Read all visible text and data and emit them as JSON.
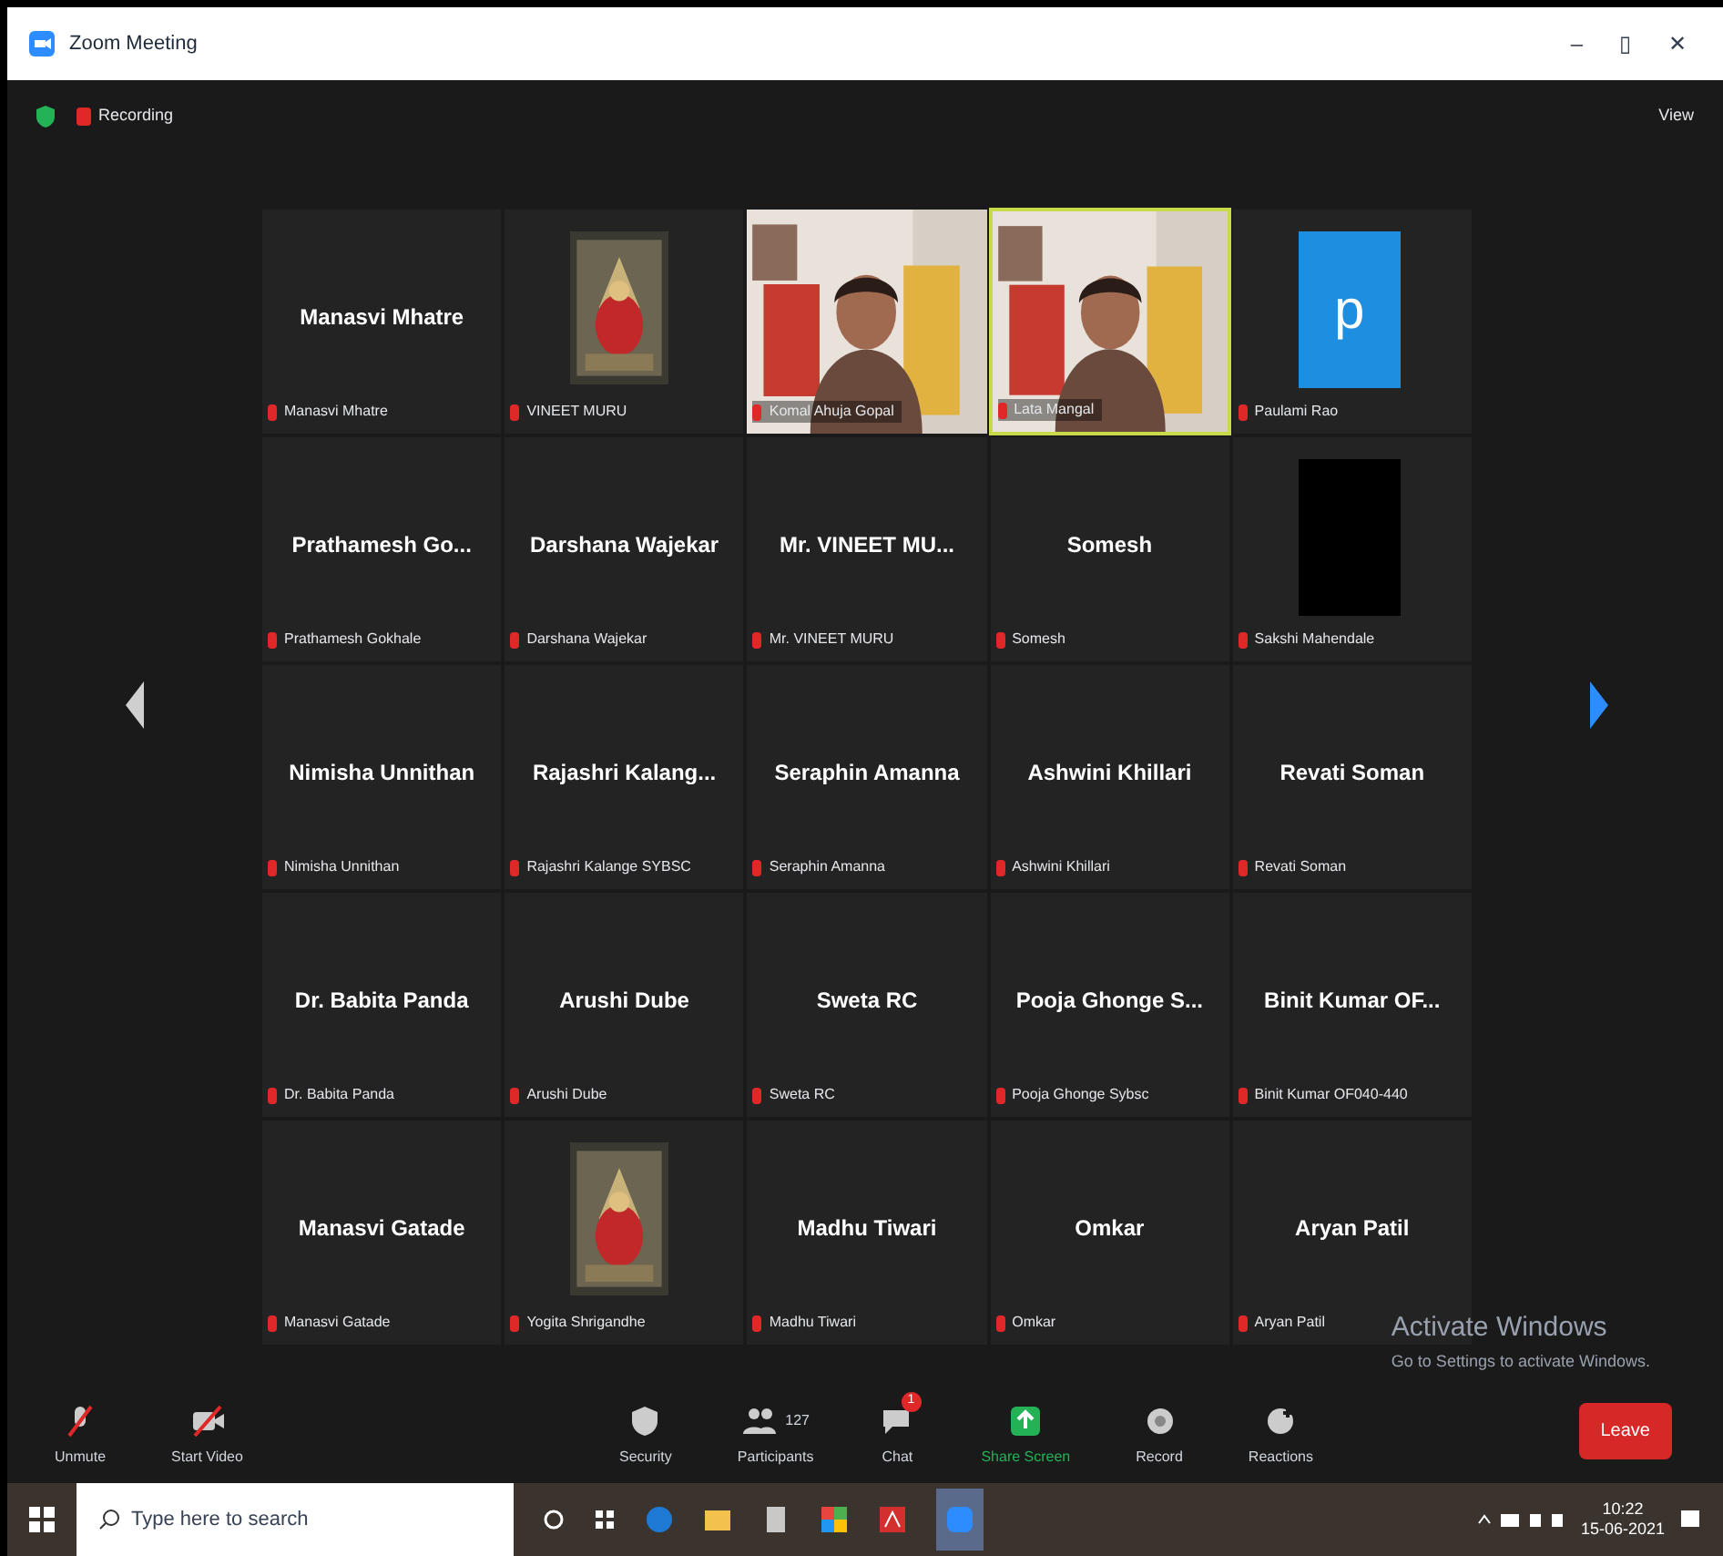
{
  "window": {
    "title": "Zoom Meeting",
    "controls": [
      "–",
      "▯",
      "✕"
    ]
  },
  "top_bar": {
    "recording": "Recording",
    "view": "View"
  },
  "tiles": [
    {
      "kind": "name",
      "name": "Manasvi Mhatre",
      "label": "Manasvi Mhatre",
      "speaking": false
    },
    {
      "kind": "picture",
      "label": "VINEET MURU",
      "speaking": false
    },
    {
      "kind": "video",
      "label": "Komal Ahuja Gopal",
      "speaking": false
    },
    {
      "kind": "video",
      "label": "Lata Mangal",
      "speaking": true
    },
    {
      "kind": "logo",
      "letter": "p",
      "label": "Paulami Rao",
      "speaking": false
    },
    {
      "kind": "name",
      "name": "Prathamesh Go...",
      "label": "Prathamesh Gokhale",
      "speaking": false
    },
    {
      "kind": "name",
      "name": "Darshana Wajekar",
      "label": "Darshana Wajekar",
      "speaking": false
    },
    {
      "kind": "name",
      "name": "Mr. VINEET MU...",
      "label": "Mr. VINEET MURU",
      "speaking": false
    },
    {
      "kind": "name",
      "name": "Somesh",
      "label": "Somesh",
      "speaking": false
    },
    {
      "kind": "blank",
      "label": "Sakshi Mahendale",
      "speaking": false
    },
    {
      "kind": "name",
      "name": "Nimisha Unnithan",
      "label": "Nimisha Unnithan",
      "speaking": false
    },
    {
      "kind": "name",
      "name": "Rajashri Kalang...",
      "label": "Rajashri Kalange SYBSC",
      "speaking": false
    },
    {
      "kind": "name",
      "name": "Seraphin Amanna",
      "label": "Seraphin Amanna",
      "speaking": false
    },
    {
      "kind": "name",
      "name": "Ashwini Khillari",
      "label": "Ashwini Khillari",
      "speaking": false
    },
    {
      "kind": "name",
      "name": "Revati Soman",
      "label": "Revati Soman",
      "speaking": false
    },
    {
      "kind": "name",
      "name": "Dr. Babita Panda",
      "label": "Dr. Babita Panda",
      "speaking": false
    },
    {
      "kind": "name",
      "name": "Arushi Dube",
      "label": "Arushi Dube",
      "speaking": false
    },
    {
      "kind": "name",
      "name": "Sweta RC",
      "label": "Sweta RC",
      "speaking": false
    },
    {
      "kind": "name",
      "name": "Pooja Ghonge S...",
      "label": "Pooja Ghonge Sybsc",
      "speaking": false
    },
    {
      "kind": "name",
      "name": "Binit Kumar OF...",
      "label": "Binit Kumar OF040-440",
      "speaking": false
    },
    {
      "kind": "name",
      "name": "Manasvi Gatade",
      "label": "Manasvi Gatade",
      "speaking": false
    },
    {
      "kind": "picture",
      "label": "Yogita Shrigandhe",
      "speaking": false
    },
    {
      "kind": "name",
      "name": "Madhu Tiwari",
      "label": "Madhu Tiwari",
      "speaking": false
    },
    {
      "kind": "name",
      "name": "Omkar",
      "label": "Omkar",
      "speaking": false
    },
    {
      "kind": "name",
      "name": "Aryan Patil",
      "label": "Aryan Patil",
      "speaking": false
    }
  ],
  "watermark_notice": {
    "title": "Activate Windows",
    "text": "Go to Settings to activate Windows."
  },
  "toolbar": [
    {
      "kind": "mic",
      "label": "Unmute"
    },
    {
      "kind": "video",
      "label": "Start Video"
    },
    {
      "kind": "security",
      "label": "Security"
    },
    {
      "kind": "participants",
      "label": "Participants",
      "count": "127"
    },
    {
      "kind": "chat",
      "label": "Chat",
      "badge": "1"
    },
    {
      "kind": "share",
      "label": "Share Screen"
    },
    {
      "kind": "record",
      "label": "Record"
    },
    {
      "kind": "reactions",
      "label": "Reactions"
    }
  ],
  "end_button": "Leave",
  "taskbar": {
    "search_placeholder": "Type here to search",
    "time": "10:22",
    "date": "15-06-2021"
  }
}
